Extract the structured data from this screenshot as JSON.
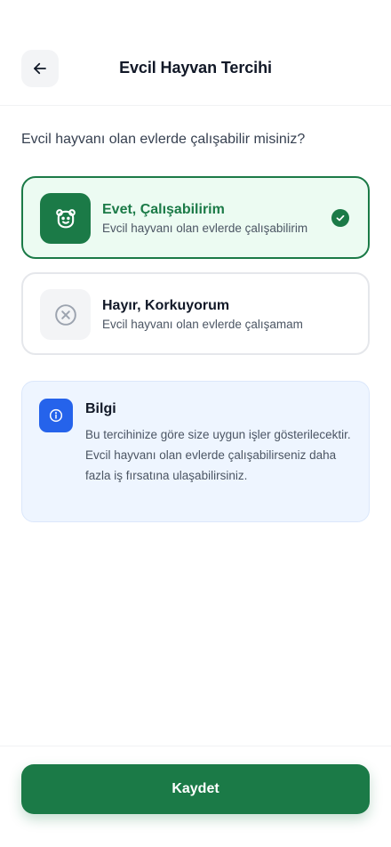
{
  "header": {
    "title": "Evcil Hayvan Tercihi",
    "back_icon": "arrow-left-icon"
  },
  "question": "Evcil hayvanı olan evlerde çalışabilir misiniz?",
  "options": [
    {
      "title": "Evet, Çalışabilirim",
      "subtitle": "Evcil hayvanı olan evlerde çalışabilirim",
      "icon": "pet-face-icon",
      "selected": true
    },
    {
      "title": "Hayır, Korkuyorum",
      "subtitle": "Evcil hayvanı olan evlerde çalışamam",
      "icon": "x-circle-icon",
      "selected": false
    }
  ],
  "info": {
    "title": "Bilgi",
    "text": "Bu tercihinize göre size uygun işler gösterilecektir. Evcil hayvanı olan evlerde çalışabilirseniz daha fazla iş fırsatına ulaşabilirsiniz.",
    "icon": "info-icon"
  },
  "footer": {
    "save_label": "Kaydet"
  },
  "colors": {
    "primary": "#1b7a47",
    "selected_bg": "#ecfbf2",
    "info_bg": "#eef5ff",
    "info_accent": "#2563eb"
  }
}
